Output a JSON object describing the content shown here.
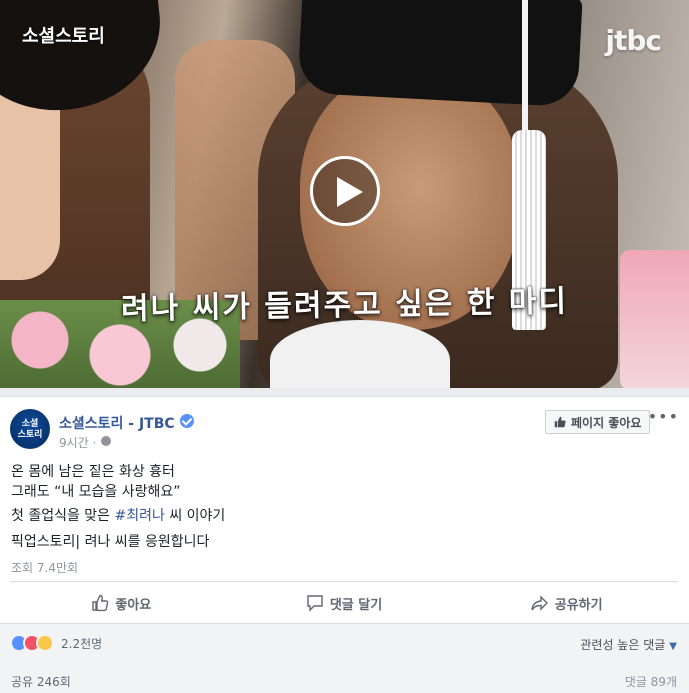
{
  "video": {
    "brand_label": "소셜스토리",
    "logo_text": "jtbc",
    "caption": "려나 씨가 들려주고 싶은 한 마디"
  },
  "post": {
    "avatar_text_line1": "소셜",
    "avatar_text_line2": "스토리",
    "page_name": "소셜스토리 - JTBC",
    "time": "9시간 ·",
    "like_page_label": "페이지 좋아요",
    "more": "•••",
    "lines": {
      "line1": "온 몸에 남은 짙은 화상 흉터",
      "line2": "그래도 “내 모습을 사랑해요”",
      "line3_prefix": "첫 졸업식을 맞은 ",
      "line3_hashtag": "#최려나",
      "line3_suffix": " 씨 이야기",
      "line4": "픽업스토리| 려나 씨를 응원합니다"
    },
    "views": "조회 7.4만회"
  },
  "actions": {
    "like": "좋아요",
    "comment": "댓글 달기",
    "share": "공유하기"
  },
  "footer": {
    "reaction_count": "2.2천명",
    "sort_label": "관련성 높은 댓글",
    "shares": "공유 246회",
    "comments": "댓글 89개"
  },
  "colors": {
    "link": "#365899",
    "verified": "#5890ff",
    "like_reaction": "#5890ff",
    "love_reaction": "#f25268"
  },
  "icons": [
    "play-icon",
    "verified-icon",
    "globe-icon",
    "thumbs-up-icon",
    "comment-icon",
    "share-icon",
    "like-reaction-icon",
    "love-reaction-icon",
    "sad-reaction-icon",
    "more-icon"
  ]
}
